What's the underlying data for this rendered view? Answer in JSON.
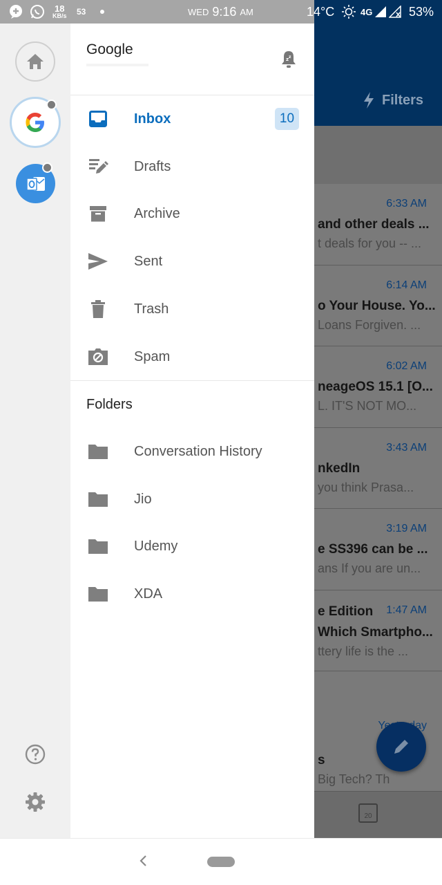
{
  "status_bar": {
    "speed_value": "18",
    "speed_unit": "KB/s",
    "notif_count": "53",
    "day": "WED",
    "time": "9:16",
    "ampm": "AM",
    "temperature": "14°C",
    "network": "4G",
    "battery": "53%"
  },
  "account": {
    "title": "Google"
  },
  "mail_nav": [
    {
      "label": "Inbox",
      "badge": "10",
      "icon": "inbox-icon"
    },
    {
      "label": "Drafts",
      "icon": "drafts-icon"
    },
    {
      "label": "Archive",
      "icon": "archive-icon"
    },
    {
      "label": "Sent",
      "icon": "sent-icon"
    },
    {
      "label": "Trash",
      "icon": "trash-icon"
    },
    {
      "label": "Spam",
      "icon": "spam-icon"
    }
  ],
  "folders": {
    "heading": "Folders",
    "items": [
      {
        "label": "Conversation History"
      },
      {
        "label": "Jio"
      },
      {
        "label": "Udemy"
      },
      {
        "label": "XDA"
      }
    ]
  },
  "background_app": {
    "filters_label": "Filters",
    "emails": [
      {
        "time": "6:33 AM",
        "subject": "and other deals ...",
        "preview": "t deals for you -- ..."
      },
      {
        "time": "6:14 AM",
        "subject": "o Your House. Yo...",
        "preview": "Loans Forgiven. ..."
      },
      {
        "time": "6:02 AM",
        "subject": "neageOS 15.1 [O...",
        "preview": "L. IT'S NOT MO..."
      },
      {
        "time": "3:43 AM",
        "subject": "nkedIn",
        "preview": " you think Prasa..."
      },
      {
        "time": "3:19 AM",
        "subject": "e SS396 can be ...",
        "preview": "ans If you are un..."
      },
      {
        "time": "1:47 AM",
        "subject": "e Edition",
        "preview2": "Which Smartpho...",
        "preview": "ttery life is the ..."
      },
      {
        "time": "Yesterday",
        "subject": "s",
        "preview": "Big Tech? Th"
      }
    ],
    "calendar_day": "20"
  },
  "colors": {
    "accent": "#0b6dbd",
    "header": "#02315f",
    "badge_bg": "#cfe4f6"
  }
}
